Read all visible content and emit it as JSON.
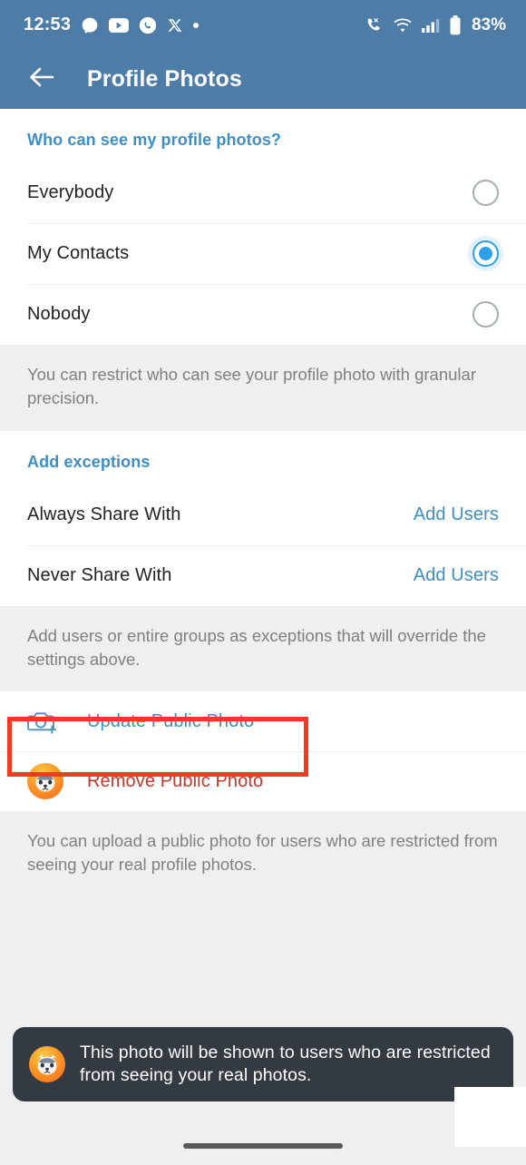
{
  "status_bar": {
    "time": "12:53",
    "battery_percent": "83%",
    "left_icons": [
      "messenger-icon",
      "youtube-icon",
      "whatsapp-icon",
      "x-twitter-icon",
      "more-dot-icon"
    ],
    "right_icons": [
      "call-mute-icon",
      "wifi-icon",
      "cellular-signal-icon",
      "battery-icon"
    ],
    "bg_color": "#4d7da6"
  },
  "app_bar": {
    "title": "Profile Photos",
    "back_icon": "arrow-left-icon",
    "bg_color": "#4d7da6"
  },
  "privacy_section": {
    "header": "Who can see my profile photos?",
    "options": [
      {
        "label": "Everybody",
        "selected": false
      },
      {
        "label": "My Contacts",
        "selected": true
      },
      {
        "label": "Nobody",
        "selected": false
      }
    ],
    "note": "You can restrict who can see your profile photo with granular precision."
  },
  "exceptions_section": {
    "header": "Add exceptions",
    "rows": [
      {
        "label": "Always Share With",
        "action": "Add Users"
      },
      {
        "label": "Never Share With",
        "action": "Add Users"
      }
    ],
    "note": "Add users or entire groups as exceptions that will override the settings above."
  },
  "public_photo_section": {
    "update": {
      "label": "Update Public Photo",
      "icon": "camera-plus-icon",
      "color": "#3c8fc4"
    },
    "remove": {
      "label": "Remove Public Photo",
      "icon": "profile-avatar-icon",
      "color": "#c0392b"
    },
    "note": "You can upload a public photo for users who are restricted from seeing your real profile photos."
  },
  "highlight": {
    "target": "Remove Public Photo",
    "border_color": "#f03a21"
  },
  "toast": {
    "message": "This photo will be shown to users who are restricted from seeing your real photos.",
    "icon": "profile-avatar-icon",
    "bg_color": "#333a41"
  },
  "nav_bar": {
    "gesture_pill": "home-gesture-pill"
  },
  "theme": {
    "accent_blue": "#3c8fc4",
    "radio_blue": "#2f9fe8",
    "page_bg": "#efefef",
    "card_bg": "#ffffff",
    "note_text": "#808080"
  }
}
